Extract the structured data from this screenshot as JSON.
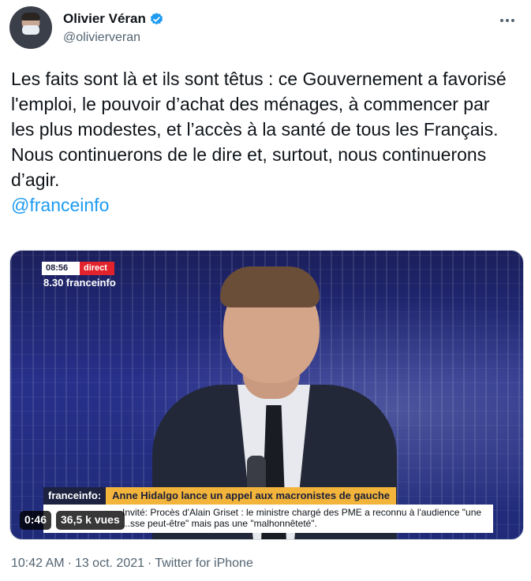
{
  "author": {
    "name": "Olivier Véran",
    "handle": "@olivierveran"
  },
  "tweet": {
    "text_lines": [
      "Les faits sont là et ils sont têtus : ce Gouvernement a favorisé l'emploi, le pouvoir d’achat des ménages, à commencer par les plus modestes, et l’accès à la santé de tous les Français.",
      "Nous continuerons de le dire et, surtout, nous continuerons d’agir."
    ],
    "mention": "@franceinfo"
  },
  "video": {
    "overlay_time": "08:56",
    "overlay_live": "direct",
    "overlay_program": "8.30 franceinfo",
    "banner_brand": "franceinfo:",
    "banner_headline": "Anne Hidalgo lance un appel aux macronistes de gauche",
    "subtitle": "Invité: Procès d'Alain Griset : le ministre chargé des PME a reconnu à l'audience \"une ...sse peut-être\" mais pas une \"malhonnêteté\".",
    "duration": "0:46",
    "views": "36,5 k vues"
  },
  "meta": {
    "time": "10:42 AM",
    "sep1": "·",
    "date": "13 oct. 2021",
    "sep2": "·",
    "source": "Twitter for iPhone"
  },
  "colors": {
    "accent": "#1d9bf0",
    "text": "#0f1419",
    "muted": "#536471",
    "live_red": "#e2232b",
    "banner_yellow": "#f2b43a"
  }
}
